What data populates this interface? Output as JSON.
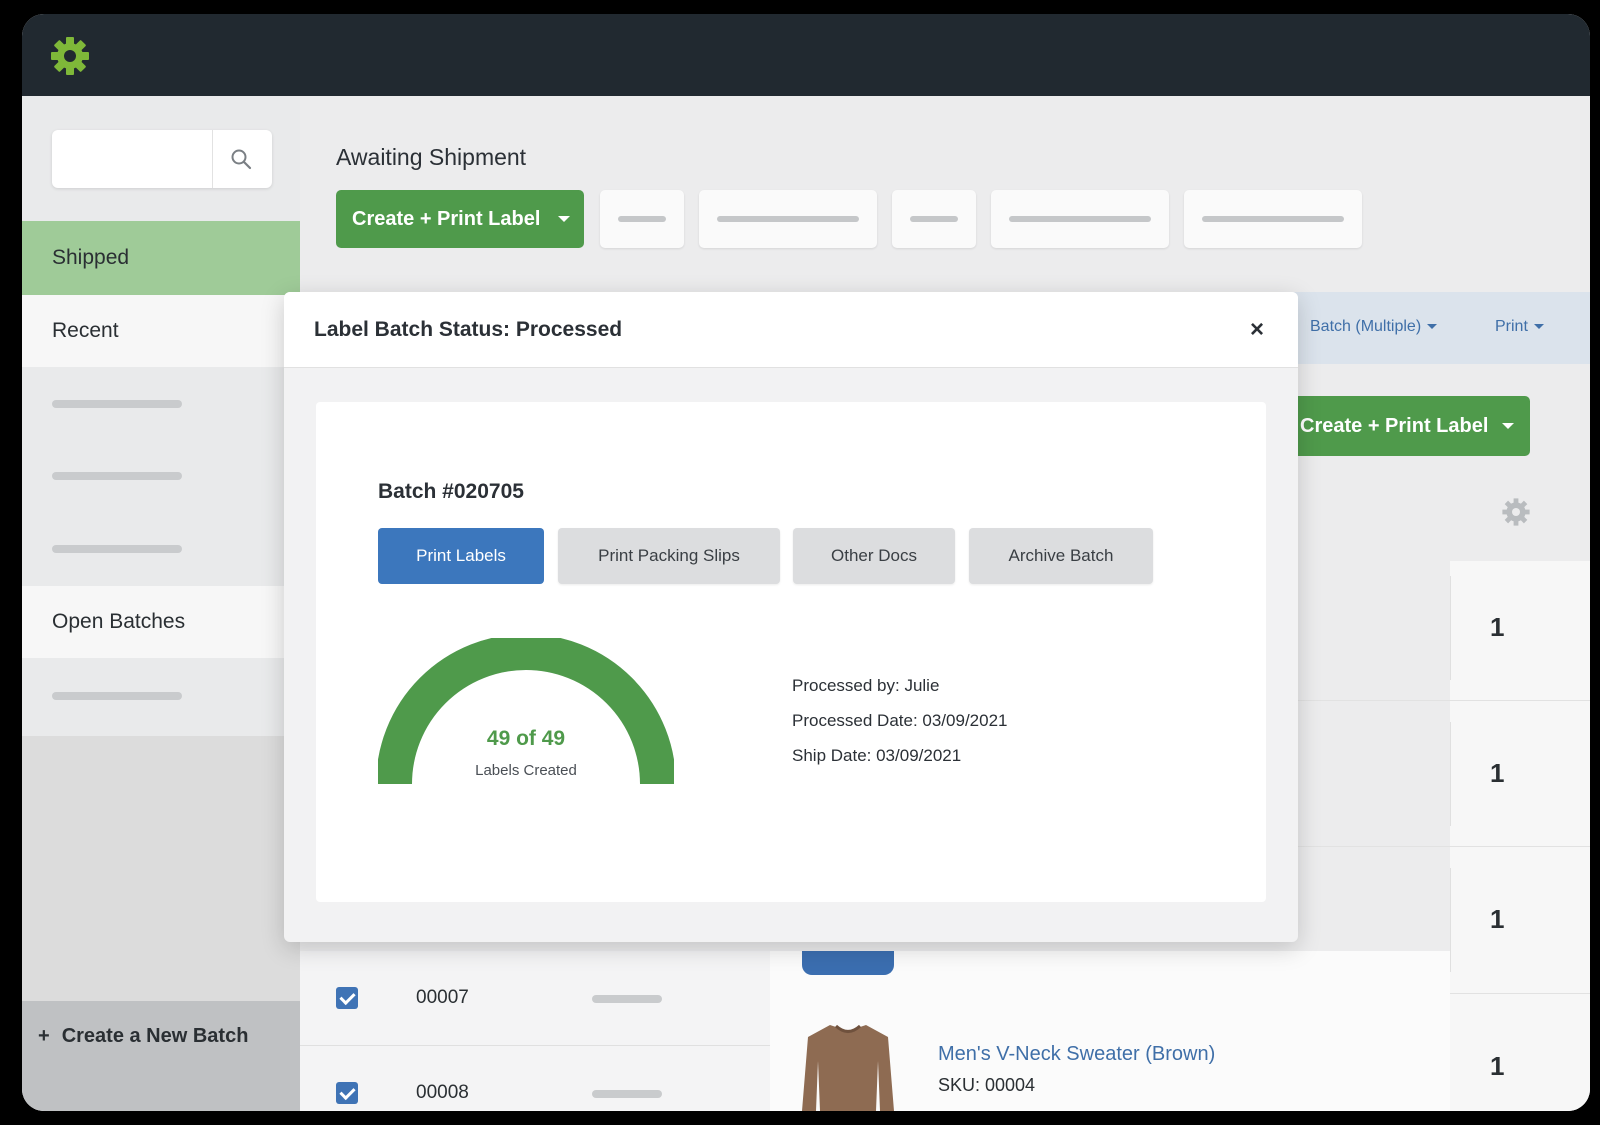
{
  "colors": {
    "topbar": "#212930",
    "brand_green": "#4f9a4b",
    "primary_blue": "#3c77bd",
    "link_blue": "#3f6fa8",
    "shipped_highlight": "#9fcb98"
  },
  "app": {
    "logo_icon": "gear-icon"
  },
  "sidebar": {
    "search": {
      "value": "",
      "icon": "search-icon"
    },
    "items": [
      {
        "label": "Shipped",
        "active": true
      },
      {
        "label": "Recent"
      },
      {
        "label": "Open Batches"
      }
    ],
    "create_batch_label": "Create a New Batch"
  },
  "main": {
    "page_title": "Awaiting Shipment",
    "create_print_label": "Create + Print Label",
    "filter_bar": {
      "batch_label": "Batch (Multiple)",
      "print_label": "Print"
    },
    "create_print_label_2": "Create + Print Label",
    "quantities": [
      "1",
      "1",
      "1",
      "1"
    ],
    "orders": [
      {
        "number": "00007",
        "checked": true
      },
      {
        "number": "00008",
        "checked": true
      }
    ],
    "product": {
      "name": "Men's V-Neck Sweater (Brown)",
      "sku": "SKU: 00004"
    }
  },
  "modal": {
    "title": "Label Batch Status: Processed",
    "close": "×",
    "batch_title": "Batch #020705",
    "buttons": {
      "print_labels": "Print Labels",
      "print_packing_slips": "Print Packing Slips",
      "other_docs": "Other Docs",
      "archive_batch": "Archive Batch"
    },
    "gauge": {
      "created": 49,
      "total": 49,
      "value_text": "49 of 49",
      "label": "Labels Created"
    },
    "info": {
      "processed_by": "Processed by: Julie",
      "processed_date": "Processed Date: 03/09/2021",
      "ship_date": "Ship Date: 03/09/2021"
    }
  }
}
